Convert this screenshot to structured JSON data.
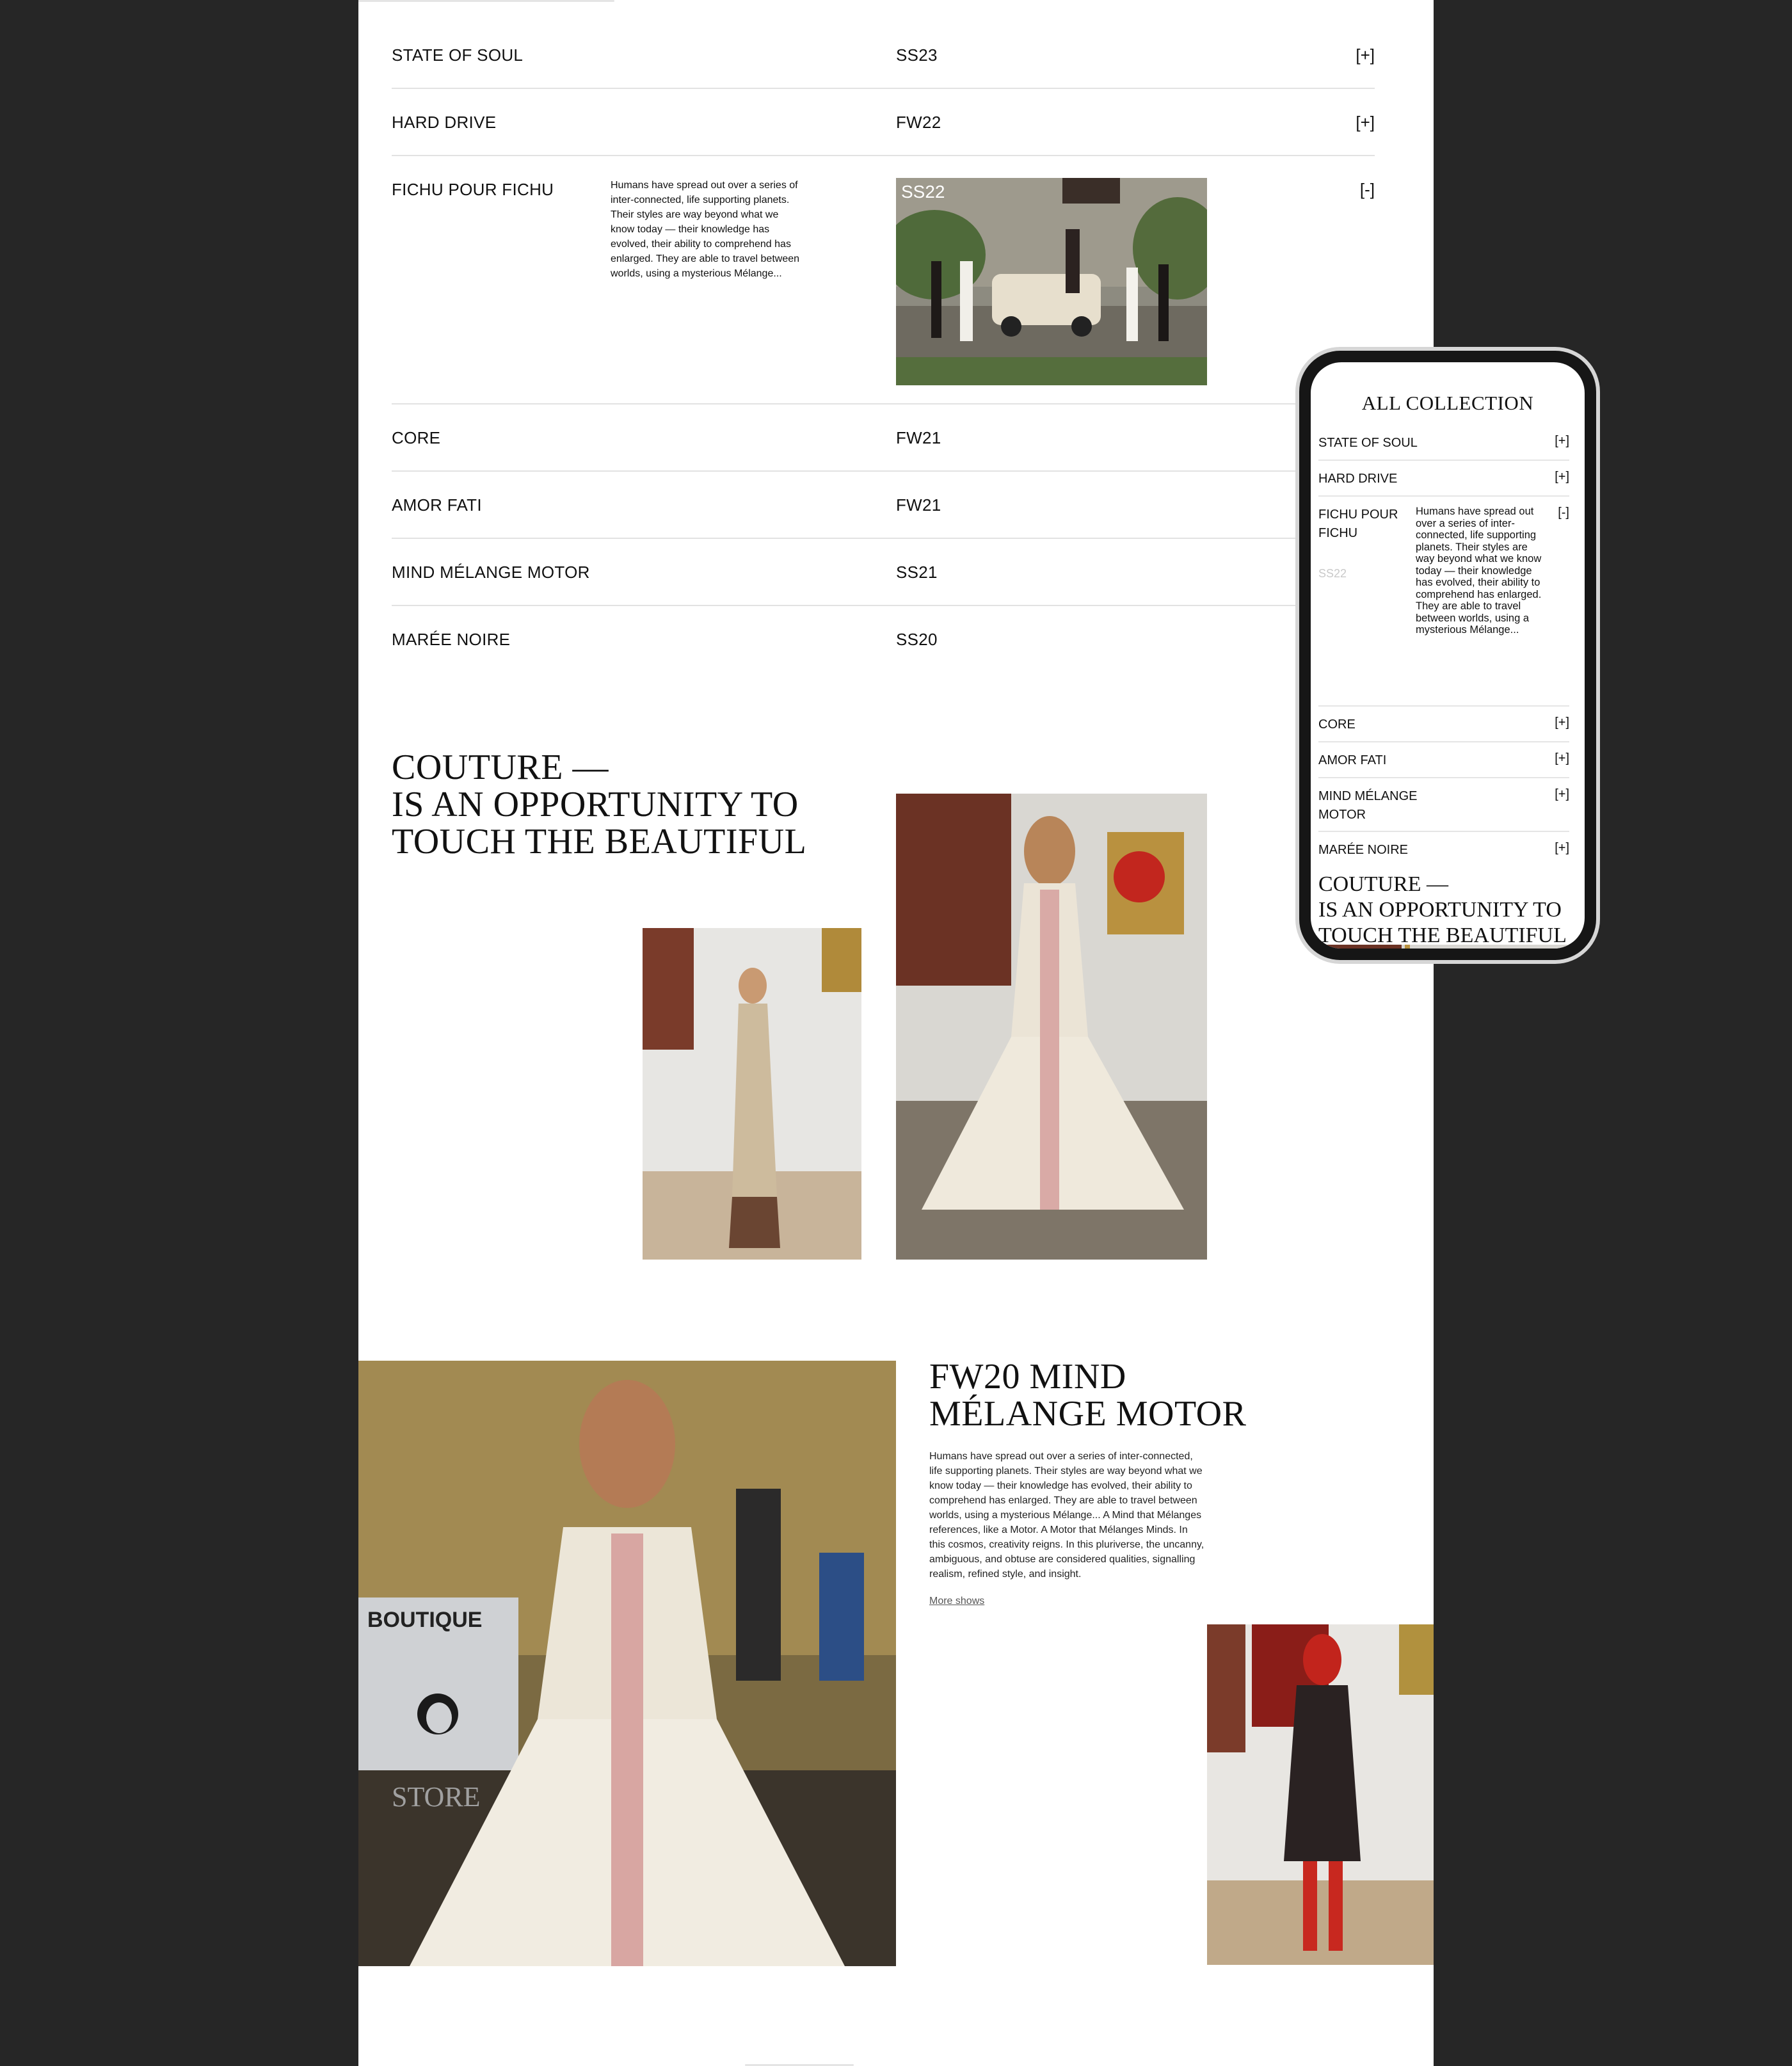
{
  "collections": [
    {
      "name": "STATE OF SOUL",
      "season": "SS23",
      "toggle": "[+]"
    },
    {
      "name": "HARD DRIVE",
      "season": "FW22",
      "toggle": "[+]"
    },
    {
      "name": "FICHU POUR FICHU",
      "season": "SS22",
      "toggle": "[-]",
      "description": "Humans have spread out over a series of inter-connected, life supporting planets. Their styles are way beyond what we know today — their knowledge has evolved, their ability to comprehend has enlarged. They are able to travel between worlds, using a mysterious Mélange..."
    },
    {
      "name": "CORE",
      "season": "FW21",
      "toggle": "[+]"
    },
    {
      "name": "AMOR FATI",
      "season": "FW21",
      "toggle": "[+]"
    },
    {
      "name": "MIND MÉLANGE MOTOR",
      "season": "SS21",
      "toggle": "[+]"
    },
    {
      "name": "MARÉE NOIRE",
      "season": "SS20",
      "toggle": "[+]"
    }
  ],
  "couture": {
    "line1": "COUTURE —",
    "line2": "IS AN OPPORTUNITY TO",
    "line3": "TOUCH THE BEAUTIFUL"
  },
  "feature": {
    "title_line1": "FW20 MIND",
    "title_line2": "MÉLANGE MOTOR",
    "text": "Humans have spread out over a series of inter-connected, life supporting planets. Their styles are way beyond what we know today — their knowledge has evolved, their ability to comprehend has enlarged. They are able to travel between worlds, using a mysterious Mélange... A Mind that Mélanges references, like a Motor. A Motor that Mélanges Minds. In this cosmos, creativity reigns. In this pluriverse, the uncanny, ambiguous, and obtuse are considered qualities, signalling realism, refined style, and insight.",
    "more_link": "More shows",
    "boutique_sign": "BOUTIQUE",
    "store_sign": "STORE"
  },
  "mobile": {
    "title": "ALL COLLECTION",
    "rows": [
      {
        "name": "STATE OF SOUL",
        "toggle": "[+]"
      },
      {
        "name": "HARD DRIVE",
        "toggle": "[+]"
      },
      {
        "name": "FICHU POUR FICHU",
        "toggle": "[-]",
        "season": "SS22",
        "description": "Humans have spread out over a series of inter-connected, life supporting planets. Their styles are way beyond what we know today — their knowledge has evolved, their ability to comprehend has enlarged. They are able to travel between worlds, using a mysterious Mélange..."
      },
      {
        "name": "CORE",
        "toggle": "[+]"
      },
      {
        "name": "AMOR FATI",
        "toggle": "[+]"
      },
      {
        "name": "MIND MÉLANGE MOTOR",
        "toggle": "[+]"
      },
      {
        "name": "MARÉE NOIRE",
        "toggle": "[+]"
      }
    ],
    "couture_line1": "COUTURE —",
    "couture_line2": "IS AN OPPORTUNITY TO",
    "couture_line3": "TOUCH THE BEAUTIFUL"
  }
}
